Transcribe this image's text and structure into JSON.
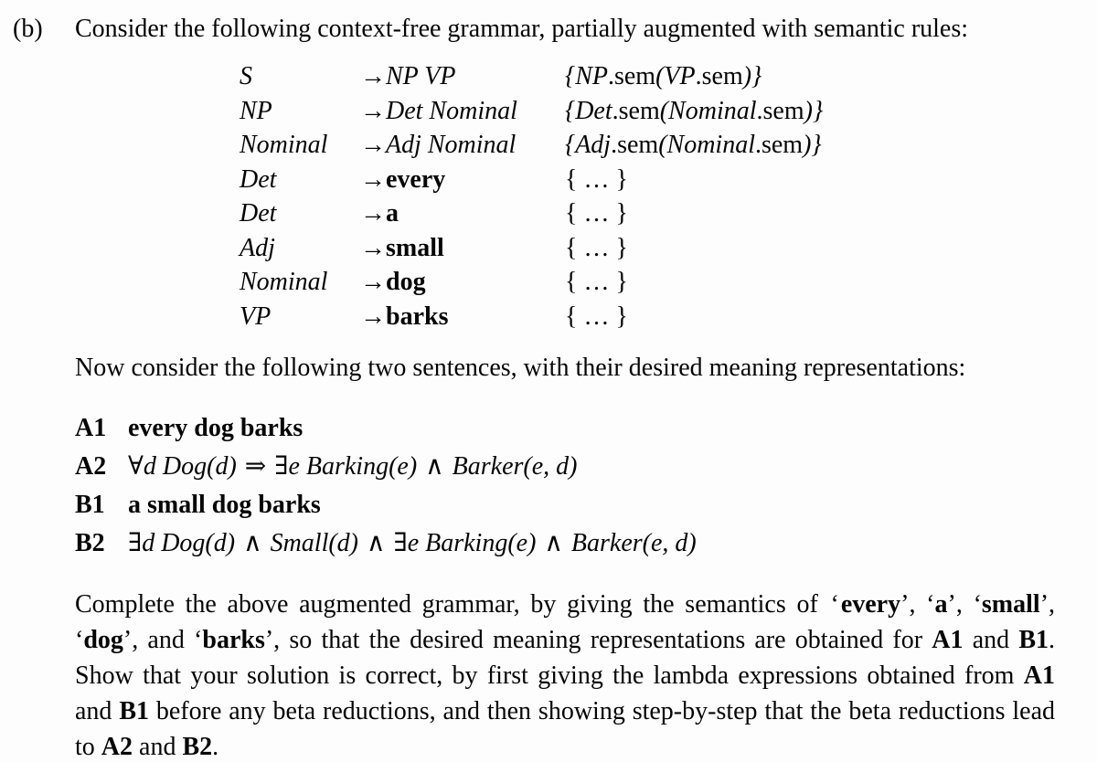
{
  "exercise": {
    "label": "(b)",
    "intro": "Consider the following context-free grammar, partially augmented with semantic rules:"
  },
  "grammar": {
    "arrow": "→",
    "rules": [
      {
        "lhs": "S",
        "rhs": "NP VP",
        "rhs_kind": "nonterminal",
        "sem": "{NP.sem(VP.sem)}",
        "sem_kind": "formula"
      },
      {
        "lhs": "NP",
        "rhs": "Det Nominal",
        "rhs_kind": "nonterminal",
        "sem": "{Det.sem(Nominal.sem)}",
        "sem_kind": "formula"
      },
      {
        "lhs": "Nominal",
        "rhs": "Adj Nominal",
        "rhs_kind": "nonterminal",
        "sem": "{Adj.sem(Nominal.sem)}",
        "sem_kind": "formula"
      },
      {
        "lhs": "Det",
        "rhs": "every",
        "rhs_kind": "terminal",
        "sem": "{ … }",
        "sem_kind": "placeholder"
      },
      {
        "lhs": "Det",
        "rhs": "a",
        "rhs_kind": "terminal",
        "sem": "{ … }",
        "sem_kind": "placeholder"
      },
      {
        "lhs": "Adj",
        "rhs": "small",
        "rhs_kind": "terminal",
        "sem": "{ … }",
        "sem_kind": "placeholder"
      },
      {
        "lhs": "Nominal",
        "rhs": "dog",
        "rhs_kind": "terminal",
        "sem": "{ … }",
        "sem_kind": "placeholder"
      },
      {
        "lhs": "VP",
        "rhs": "barks",
        "rhs_kind": "terminal",
        "sem": "{ … }",
        "sem_kind": "placeholder"
      }
    ]
  },
  "middle_paragraph": "Now consider the following two sentences, with their desired meaning representations:",
  "sentences": [
    {
      "tag": "A1",
      "kind": "sentence",
      "text": "every dog barks"
    },
    {
      "tag": "A2",
      "kind": "formula",
      "text": "∀d Dog(d) ⇒ ∃e Barking(e)  ∧ Barker(e, d)"
    },
    {
      "tag": "B1",
      "kind": "sentence",
      "text": "a small dog barks"
    },
    {
      "tag": "B2",
      "kind": "formula",
      "text": "∃d Dog(d) ∧ Small(d) ∧ ∃e Barking(e)  ∧ Barker(e, d)"
    }
  ],
  "closing_paragraph": {
    "part1": "Complete the above augmented grammar, by giving the semantics of ",
    "word1": "every",
    "sep1": "’, ‘",
    "word2": "a",
    "sep2": "’, ‘",
    "word3": "small",
    "sep3": "’, ‘",
    "word4": "dog",
    "sep4": "’, and ‘",
    "word5": "barks",
    "part2": "’, so that the desired meaning representations are obtained for ",
    "ref1": "A1",
    "part3": " and ",
    "ref2": "B1",
    "part4": ".  Show that your solution is correct, by first giving the lambda expressions obtained from ",
    "ref3": "A1",
    "part5": " and ",
    "ref4": "B1",
    "part6": " before any beta reductions, and then showing step-by-step that the beta reductions lead to ",
    "ref5": "A2",
    "part7": " and ",
    "ref6": "B2",
    "part8": "."
  },
  "colors": {
    "text": "#050505",
    "background": "#fdfdfd"
  }
}
